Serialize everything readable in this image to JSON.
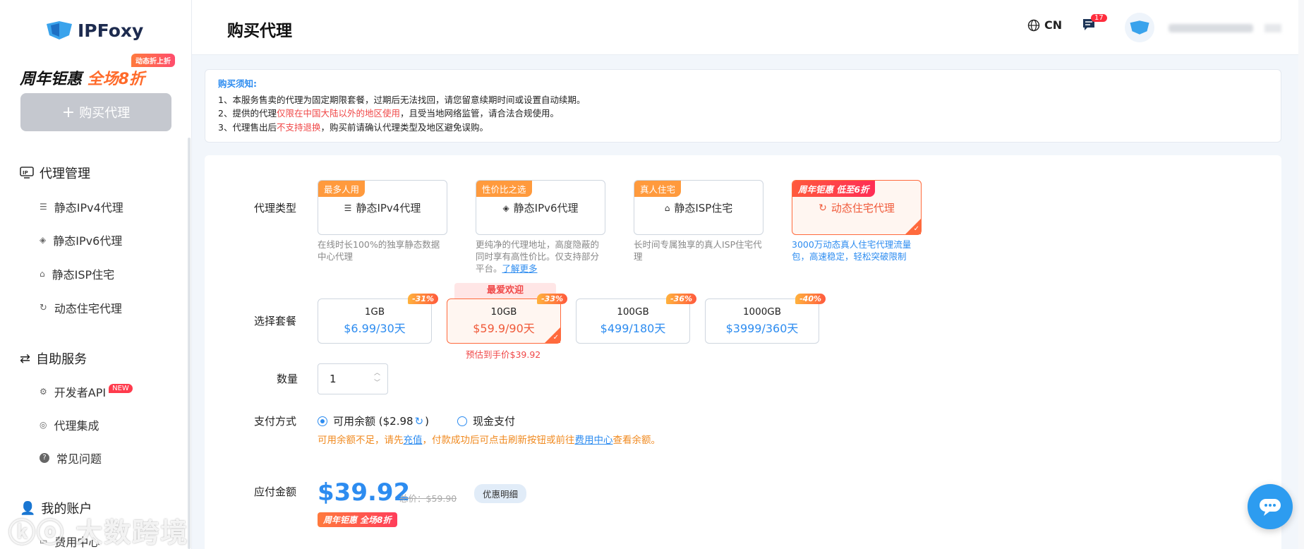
{
  "sidebar": {
    "logo": "IPFoxy",
    "promo": {
      "tag": "动态折上折",
      "main_a": "周年钜惠",
      "main_b": "全场8折"
    },
    "buy_button": "购买代理",
    "groups": [
      {
        "label": "代理管理",
        "items": [
          {
            "label": "静态IPv4代理"
          },
          {
            "label": "静态IPv6代理"
          },
          {
            "label": "静态ISP住宅"
          },
          {
            "label": "动态住宅代理"
          }
        ]
      },
      {
        "label": "自助服务",
        "items": [
          {
            "label": "开发者API",
            "badge": "NEW"
          },
          {
            "label": "代理集成"
          },
          {
            "label": "常见问题"
          }
        ]
      },
      {
        "label": "我的账户",
        "items": [
          {
            "label": "费用中心"
          }
        ]
      }
    ],
    "watermark": "大数跨境"
  },
  "header": {
    "title": "购买代理",
    "lang": "CN",
    "msg_count": "17"
  },
  "notice": {
    "title": "购买须知:",
    "l1": "1、本服务售卖的代理为固定期限套餐，过期后无法找回，请您留意续期时间或设置自动续期。",
    "l2a": "2、提供的代理",
    "l2red": "仅限在中国大陆以外的地区使用",
    "l2b": "，且受当地网络监管，请合法合规使用。",
    "l3a": "3、代理售出后",
    "l3red": "不支持退换",
    "l3b": "，购买前请确认代理类型及地区避免误购。"
  },
  "form": {
    "type_label": "代理类型",
    "types": [
      {
        "tag": "最多人用",
        "name": "静态IPv4代理",
        "desc": "在线时长100%的独享静态数据中心代理"
      },
      {
        "tag": "性价比之选",
        "name": "静态IPv6代理",
        "desc": "更纯净的代理地址，高度隐蔽的同时享有高性价比。仅支持部分平台。",
        "link": "了解更多"
      },
      {
        "tag": "真人住宅",
        "name": "静态ISP住宅",
        "desc": "长时间专属独享的真人ISP住宅代理"
      },
      {
        "tag": "周年钜惠 低至6折",
        "name": "动态住宅代理",
        "desc": "3000万动态真人住宅代理流量包，高速稳定，轻松突破限制"
      }
    ],
    "pkg_label": "选择套餐",
    "popular": "最爱欢迎",
    "packages": [
      {
        "size": "1GB",
        "price": "$6.99/30天",
        "disc": "-31%"
      },
      {
        "size": "10GB",
        "price": "$59.9/90天",
        "disc": "-33%"
      },
      {
        "size": "100GB",
        "price": "$499/180天",
        "disc": "-36%"
      },
      {
        "size": "1000GB",
        "price": "$3999/360天",
        "disc": "-40%"
      }
    ],
    "estimate": "预估到手价$39.92",
    "qty_label": "数量",
    "qty_value": "1",
    "pay_label": "支付方式",
    "pay_balance": "可用余额 ($2.98",
    "pay_balance_end": ")",
    "pay_cash": "现金支付",
    "hint_a": "可用余额不足，请先",
    "hint_link1": "充值",
    "hint_b": "，付款成功后可点击刷新按钮或前往",
    "hint_link2": "费用中心",
    "hint_c": "查看余额。",
    "amount_label": "应付金额",
    "amount": "$39.92",
    "orig_price": "总价：$59.90",
    "detail_btn": "优惠明细",
    "promo_small": "周年钜惠 全场8折"
  }
}
